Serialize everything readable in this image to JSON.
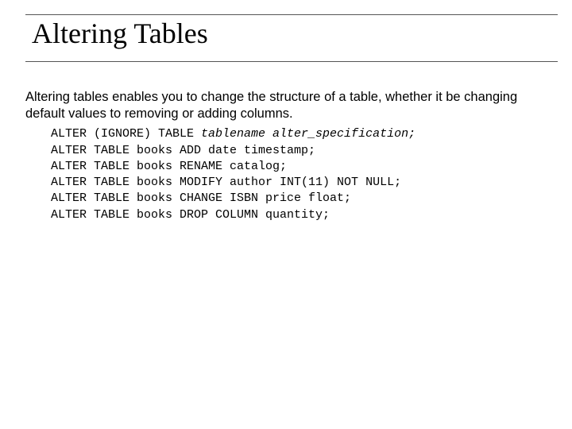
{
  "title": "Altering Tables",
  "intro": "Altering tables enables you to change the structure of a table, whether it be changing default values to removing or adding columns.",
  "code": {
    "syntax_prefix": "ALTER (IGNORE) TABLE ",
    "syntax_italic": "tablename alter_specification;",
    "lines": [
      "ALTER TABLE books ADD date timestamp;",
      "ALTER TABLE books RENAME catalog;",
      "ALTER TABLE books MODIFY author INT(11) NOT NULL;",
      "ALTER TABLE books CHANGE ISBN price float;",
      "ALTER TABLE books DROP COLUMN quantity;"
    ]
  }
}
